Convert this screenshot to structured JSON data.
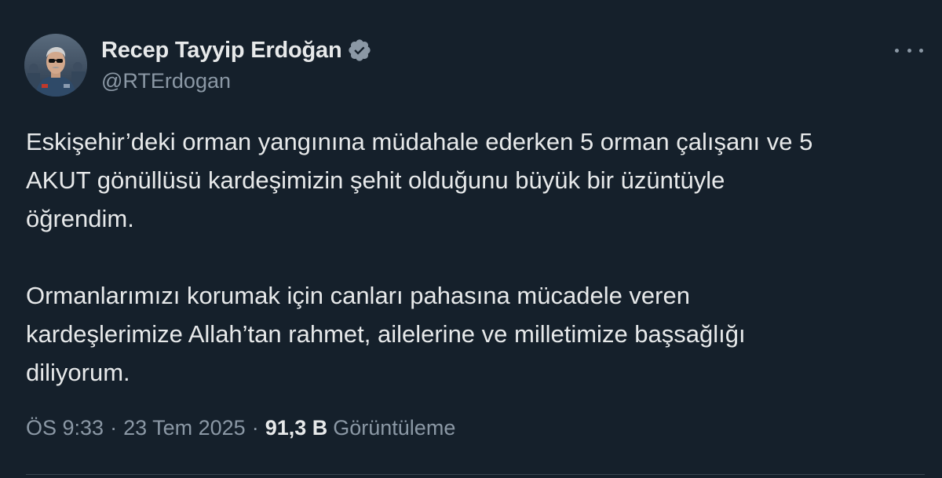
{
  "author": {
    "display_name": "Recep Tayyip Erdoğan",
    "handle": "@RTErdogan",
    "verified": true,
    "verified_icon": "verified-badge-icon",
    "verified_color": "#8b98a5"
  },
  "tweet": {
    "paragraphs": [
      "Eskişehir’deki orman yangınına müdahale ederken 5 orman çalışanı ve 5\nAKUT gönüllüsü kardeşimizin şehit olduğunu büyük bir üzüntüyle\nöğrendim.",
      "Ormanlarımızı korumak için canları pahasına mücadele veren\nkardeşlerimize Allah’tan rahmet, ailelerine ve milletimize başsağlığı\ndiliyorum."
    ]
  },
  "meta": {
    "time": "ÖS 9:33",
    "date": "23 Tem 2025",
    "separator": "·",
    "views_count": "91,3 B",
    "views_label": "Görüntüleme"
  },
  "menu": {
    "icon": "more-options-icon"
  },
  "colors": {
    "background": "#15202b",
    "text_primary": "#e7e9ea",
    "text_secondary": "#8b98a5",
    "divider": "#38444d"
  }
}
